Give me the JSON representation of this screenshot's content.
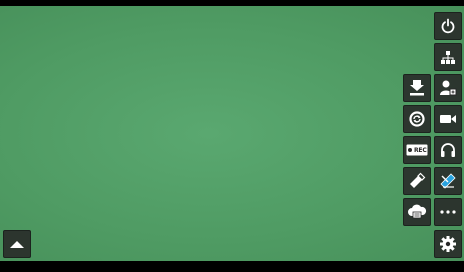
{
  "colors": {
    "background": "#4f9b63",
    "button": "#282828",
    "icon": "#ffffff",
    "accent": "#29a3e0"
  },
  "toolbar": {
    "right_column": [
      "power-icon",
      "network-icon",
      "contact-icon",
      "camera-icon",
      "headphones-icon",
      "screen-draw-icon",
      "more-icon",
      "settings-icon"
    ],
    "left_column": [
      "download-icon",
      "sync-icon",
      "record-icon",
      "usb-icon",
      "cloud-icon"
    ],
    "record_label": "REC"
  },
  "bottom_left": {
    "expand_icon": "chevron-up-icon"
  }
}
